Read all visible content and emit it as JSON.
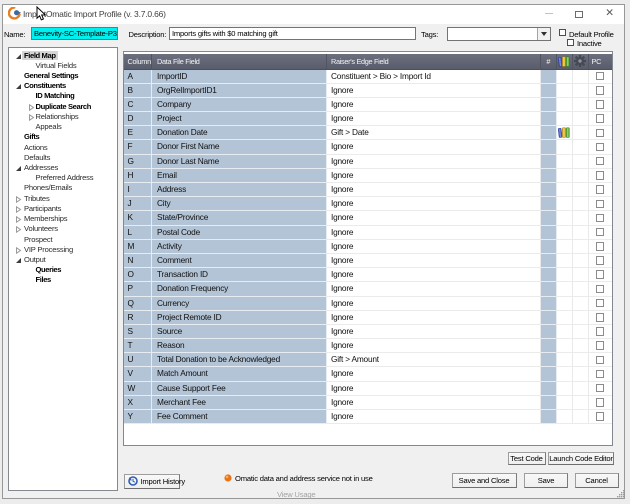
{
  "window": {
    "title": "ImportOmatic Import Profile (v. 3.7.0.66)"
  },
  "profile": {
    "name_label": "Name:",
    "name_value": "Benevity-SC-Template-P3",
    "description_label": "Description:",
    "description_value": "Imports gifts with $0 matching gift",
    "tags_label": "Tags:",
    "tags_value": "",
    "default_profile_label": "Default Profile",
    "inactive_label": "Inactive"
  },
  "tree": {
    "items": [
      {
        "label": "Field Map",
        "bold": true,
        "state": "expanded",
        "level": 0,
        "selected": true
      },
      {
        "label": "Virtual Fields",
        "bold": false,
        "state": "none",
        "level": 1,
        "selected": false
      },
      {
        "label": "General Settings",
        "bold": true,
        "state": "none",
        "level": 0,
        "selected": false
      },
      {
        "label": "Constituents",
        "bold": true,
        "state": "expanded",
        "level": 0,
        "selected": false
      },
      {
        "label": "ID Matching",
        "bold": true,
        "state": "none",
        "level": 1,
        "selected": false
      },
      {
        "label": "Duplicate Search",
        "bold": true,
        "state": "collapsed",
        "level": 1,
        "selected": false
      },
      {
        "label": "Relationships",
        "bold": false,
        "state": "collapsed",
        "level": 1,
        "selected": false
      },
      {
        "label": "Appeals",
        "bold": false,
        "state": "none",
        "level": 1,
        "selected": false
      },
      {
        "label": "Gifts",
        "bold": true,
        "state": "none",
        "level": 0,
        "selected": false
      },
      {
        "label": "Actions",
        "bold": false,
        "state": "none",
        "level": 0,
        "selected": false
      },
      {
        "label": "Defaults",
        "bold": false,
        "state": "none",
        "level": 0,
        "selected": false
      },
      {
        "label": "Addresses",
        "bold": false,
        "state": "expanded",
        "level": 0,
        "selected": false
      },
      {
        "label": "Preferred Address",
        "bold": false,
        "state": "none",
        "level": 1,
        "selected": false
      },
      {
        "label": "Phones/Emails",
        "bold": false,
        "state": "none",
        "level": 0,
        "selected": false
      },
      {
        "label": "Tributes",
        "bold": false,
        "state": "collapsed",
        "level": 0,
        "selected": false
      },
      {
        "label": "Participants",
        "bold": false,
        "state": "collapsed",
        "level": 0,
        "selected": false
      },
      {
        "label": "Memberships",
        "bold": false,
        "state": "collapsed",
        "level": 0,
        "selected": false
      },
      {
        "label": "Volunteers",
        "bold": false,
        "state": "collapsed",
        "level": 0,
        "selected": false
      },
      {
        "label": "Prospect",
        "bold": false,
        "state": "none",
        "level": 0,
        "selected": false
      },
      {
        "label": "VIP Processing",
        "bold": false,
        "state": "collapsed",
        "level": 0,
        "selected": false
      },
      {
        "label": "Output",
        "bold": false,
        "state": "expanded",
        "level": 0,
        "selected": false
      },
      {
        "label": "Queries",
        "bold": true,
        "state": "none",
        "level": 1,
        "selected": false
      },
      {
        "label": "Files",
        "bold": true,
        "state": "none",
        "level": 1,
        "selected": false
      }
    ]
  },
  "grid": {
    "headers": {
      "column": "Column",
      "data_file_field": "Data File Field",
      "raisers_edge_field": "Raiser's Edge Field",
      "hash": "#",
      "pc": "PC"
    },
    "rows": [
      {
        "column": "A",
        "field": "ImportID",
        "re_field": "Constituent > Bio > Import Id",
        "dict_icon": false
      },
      {
        "column": "B",
        "field": "OrgRelImportID1",
        "re_field": "Ignore",
        "dict_icon": false
      },
      {
        "column": "C",
        "field": "Company",
        "re_field": "Ignore",
        "dict_icon": false
      },
      {
        "column": "D",
        "field": "Project",
        "re_field": "Ignore",
        "dict_icon": false
      },
      {
        "column": "E",
        "field": "Donation Date",
        "re_field": "Gift > Date",
        "dict_icon": true
      },
      {
        "column": "F",
        "field": "Donor First Name",
        "re_field": "Ignore",
        "dict_icon": false
      },
      {
        "column": "G",
        "field": "Donor Last Name",
        "re_field": "Ignore",
        "dict_icon": false
      },
      {
        "column": "H",
        "field": "Email",
        "re_field": "Ignore",
        "dict_icon": false
      },
      {
        "column": "I",
        "field": "Address",
        "re_field": "Ignore",
        "dict_icon": false
      },
      {
        "column": "J",
        "field": "City",
        "re_field": "Ignore",
        "dict_icon": false
      },
      {
        "column": "K",
        "field": "State/Province",
        "re_field": "Ignore",
        "dict_icon": false
      },
      {
        "column": "L",
        "field": "Postal Code",
        "re_field": "Ignore",
        "dict_icon": false
      },
      {
        "column": "M",
        "field": "Activity",
        "re_field": "Ignore",
        "dict_icon": false
      },
      {
        "column": "N",
        "field": "Comment",
        "re_field": "Ignore",
        "dict_icon": false
      },
      {
        "column": "O",
        "field": "Transaction ID",
        "re_field": "Ignore",
        "dict_icon": false
      },
      {
        "column": "P",
        "field": "Donation Frequency",
        "re_field": "Ignore",
        "dict_icon": false
      },
      {
        "column": "Q",
        "field": "Currency",
        "re_field": "Ignore",
        "dict_icon": false
      },
      {
        "column": "R",
        "field": "Project Remote ID",
        "re_field": "Ignore",
        "dict_icon": false
      },
      {
        "column": "S",
        "field": "Source",
        "re_field": "Ignore",
        "dict_icon": false
      },
      {
        "column": "T",
        "field": "Reason",
        "re_field": "Ignore",
        "dict_icon": false
      },
      {
        "column": "U",
        "field": "Total Donation to be Acknowledged",
        "re_field": "Gift > Amount",
        "dict_icon": false
      },
      {
        "column": "V",
        "field": "Match Amount",
        "re_field": "Ignore",
        "dict_icon": false
      },
      {
        "column": "W",
        "field": "Cause Support Fee",
        "re_field": "Ignore",
        "dict_icon": false
      },
      {
        "column": "X",
        "field": "Merchant Fee",
        "re_field": "Ignore",
        "dict_icon": false
      },
      {
        "column": "Y",
        "field": "Fee Comment",
        "re_field": "Ignore",
        "dict_icon": false
      }
    ]
  },
  "actions": {
    "test_code": "Test Code",
    "launch_code_editor": "Launch Code Editor",
    "import_history": "Import History",
    "save_and_close": "Save and Close",
    "save": "Save",
    "cancel": "Cancel"
  },
  "status": {
    "message": "Omatic data and address service not in use",
    "link": "View Usage"
  },
  "colors": {
    "selection_cyan": "#00efef",
    "row_blue": "#b3c4d6",
    "header_dark": "#5d6170",
    "status_orange": "#ee7f22"
  }
}
